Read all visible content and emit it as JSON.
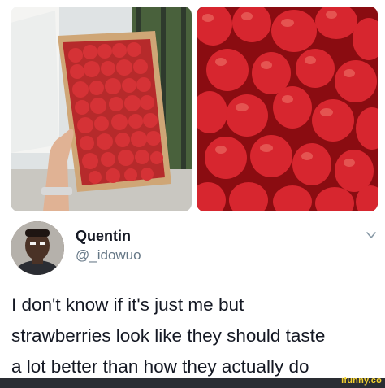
{
  "tweet": {
    "display_name": "Quentin",
    "handle": "@_idowuo",
    "text": "I don't know if it's just me but\nstrawberries look like they should taste\na lot better than how they actually do"
  },
  "icons": {
    "more": "chevron-down-icon"
  },
  "watermark": {
    "text": "ifunny.co"
  },
  "colors": {
    "text": "#141823",
    "secondary_text": "#657786",
    "strawberry_red": "#d7262f",
    "footer_bar": "#2a2d33",
    "watermark": "#f4d230"
  }
}
